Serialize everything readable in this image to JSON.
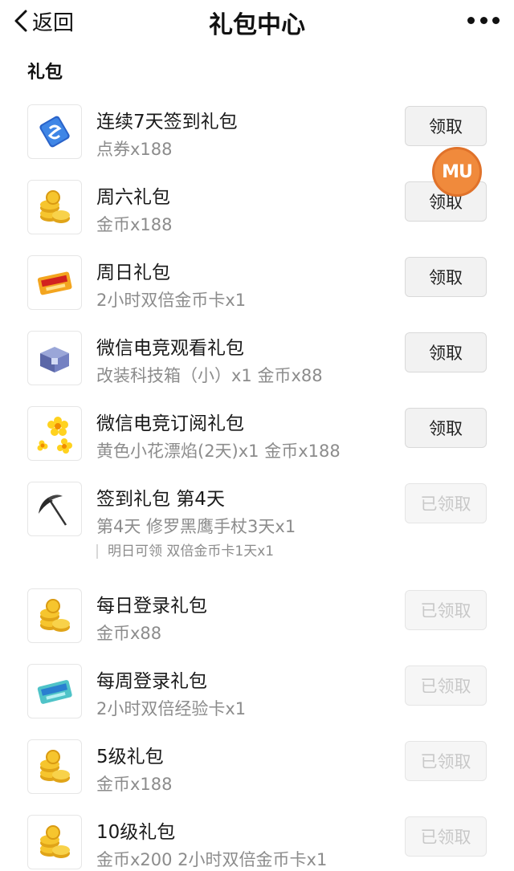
{
  "navbar": {
    "back_label": "返回",
    "title": "礼包中心"
  },
  "section": {
    "title": "礼包"
  },
  "gifts": [
    {
      "name": "连续7天签到礼包",
      "desc": "点券x188",
      "button": "领取",
      "status": "active",
      "icon": "voucher-card-icon"
    },
    {
      "name": "周六礼包",
      "desc": "金币x188",
      "button": "领取",
      "status": "active",
      "icon": "gold-coins-icon"
    },
    {
      "name": "周日礼包",
      "desc": "2小时双倍金币卡x1",
      "button": "领取",
      "status": "active",
      "icon": "double-gold-card-icon"
    },
    {
      "name": "微信电竞观看礼包",
      "desc": "改装科技箱（小）x1 金币x88",
      "button": "领取",
      "status": "active",
      "icon": "tech-box-icon"
    },
    {
      "name": "微信电竞订阅礼包",
      "desc": "黄色小花漂焰(2天)x1 金币x188",
      "button": "领取",
      "status": "active",
      "icon": "yellow-flowers-icon"
    },
    {
      "name": "签到礼包 第4天",
      "desc": "第4天 修罗黑鹰手杖3天x1",
      "tip": "明日可领 双倍金币卡1天x1",
      "button": "已领取",
      "status": "claimed",
      "icon": "scythe-icon"
    },
    {
      "name": "每日登录礼包",
      "desc": "金币x88",
      "button": "已领取",
      "status": "claimed",
      "icon": "gold-coins-icon"
    },
    {
      "name": "每周登录礼包",
      "desc": "2小时双倍经验卡x1",
      "button": "已领取",
      "status": "claimed",
      "icon": "double-exp-card-icon"
    },
    {
      "name": "5级礼包",
      "desc": "金币x188",
      "button": "已领取",
      "status": "claimed",
      "icon": "gold-coins-icon"
    },
    {
      "name": "10级礼包",
      "desc": "金币x200 2小时双倍金币卡x1",
      "button": "已领取",
      "status": "claimed",
      "icon": "gold-coins-icon"
    }
  ],
  "overlay_badge": {
    "text": "MU",
    "color": "#f08a3c"
  },
  "colors": {
    "button_active_text": "#222222",
    "button_claimed_text": "#c8c8c8",
    "desc_text": "#8c8c8c"
  }
}
